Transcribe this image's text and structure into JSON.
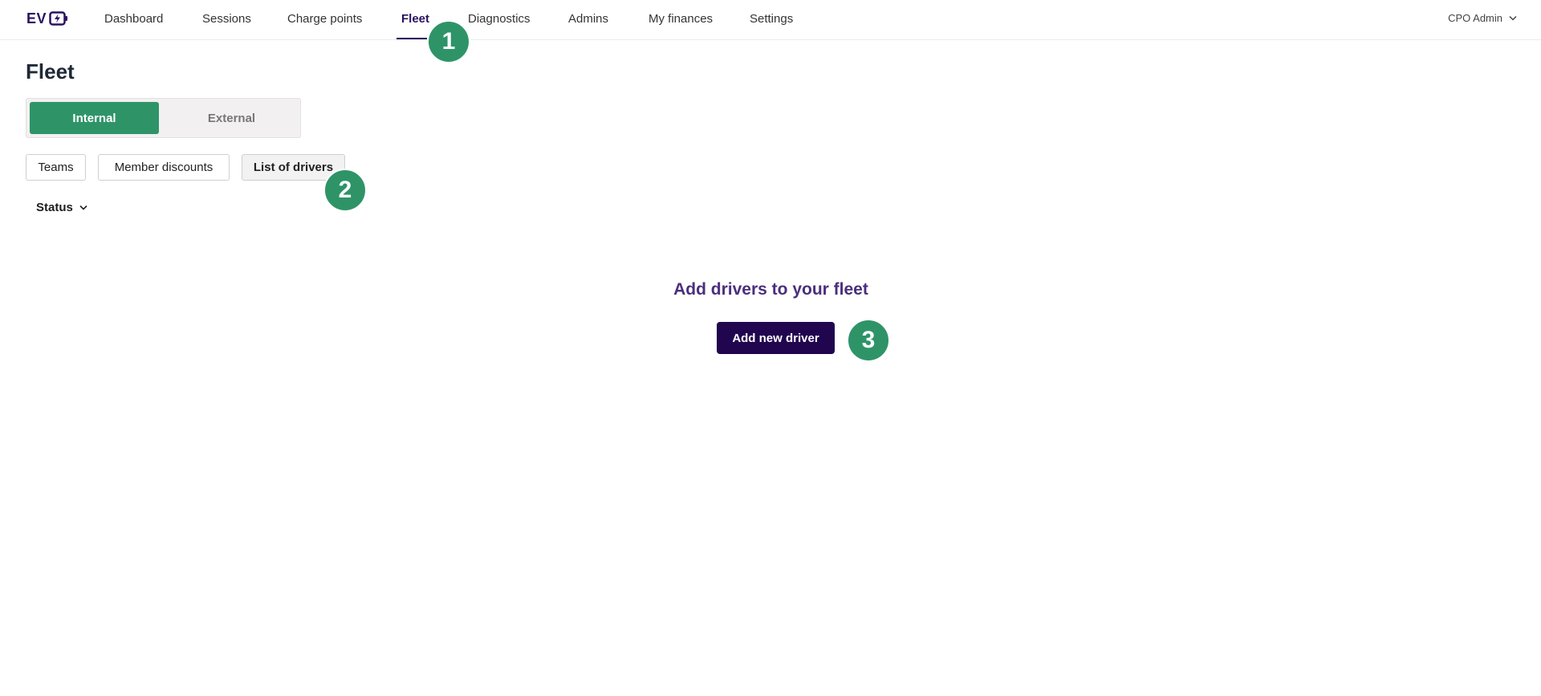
{
  "header": {
    "logo_text": "EV",
    "nav": [
      {
        "label": "Dashboard"
      },
      {
        "label": "Sessions"
      },
      {
        "label": "Charge points"
      },
      {
        "label": "Fleet"
      },
      {
        "label": "Diagnostics"
      },
      {
        "label": "Admins"
      },
      {
        "label": "My finances"
      },
      {
        "label": "Settings"
      }
    ],
    "active_nav": "Fleet",
    "user_label": "CPO Admin"
  },
  "page": {
    "title": "Fleet",
    "segments": [
      {
        "label": "Internal",
        "active": true
      },
      {
        "label": "External",
        "active": false
      }
    ],
    "subtabs": [
      {
        "label": "Teams",
        "active": false
      },
      {
        "label": "Member discounts",
        "active": false
      },
      {
        "label": "List of drivers",
        "active": true
      }
    ],
    "status_filter_label": "Status",
    "empty_state_title": "Add drivers to your fleet",
    "add_button_label": "Add new driver"
  },
  "annotations": [
    {
      "label": "1"
    },
    {
      "label": "2"
    },
    {
      "label": "3"
    }
  ],
  "colors": {
    "brand": "#2a1260",
    "accent_green": "#2e9468",
    "primary_button": "#21054f",
    "empty_title": "#4a2f7c"
  }
}
